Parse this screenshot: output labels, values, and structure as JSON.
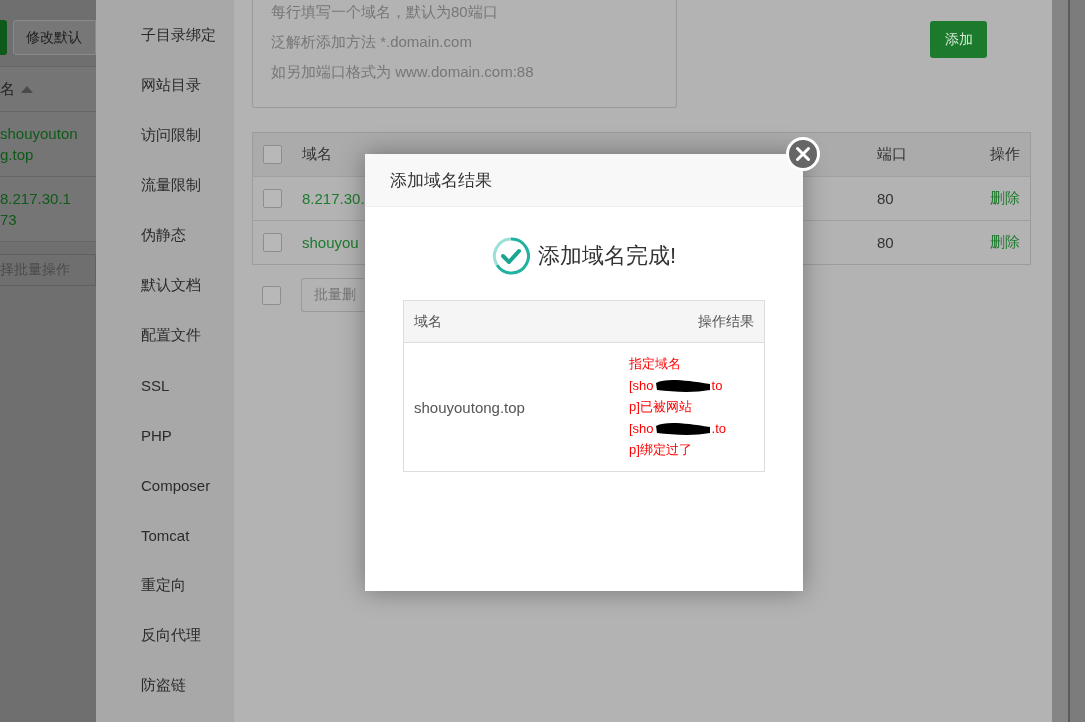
{
  "background_page": {
    "buttons": [
      "修改默认"
    ],
    "table": {
      "column": "名",
      "rows": [
        {
          "domain": "shouyoutong.top"
        },
        {
          "domain": "8.217.30.173"
        }
      ]
    },
    "batch_select": {
      "value": "择批量操作"
    }
  },
  "sidebar": {
    "items": [
      {
        "label": "子目录绑定"
      },
      {
        "label": "网站目录"
      },
      {
        "label": "访问限制"
      },
      {
        "label": "流量限制"
      },
      {
        "label": "伪静态"
      },
      {
        "label": "默认文档"
      },
      {
        "label": "配置文件"
      },
      {
        "label": "SSL"
      },
      {
        "label": "PHP"
      },
      {
        "label": "Composer"
      },
      {
        "label": "Tomcat"
      },
      {
        "label": "重定向"
      },
      {
        "label": "反向代理"
      },
      {
        "label": "防盗链"
      }
    ]
  },
  "domain_form": {
    "hint_lines": [
      "每行填写一个域名，默认为80端口",
      "泛解析添加方法 *.domain.com",
      "如另加端口格式为 www.domain.com:88"
    ],
    "add_button": "添加"
  },
  "domain_table": {
    "select_all_checked": false,
    "bottom_checked": false,
    "columns": [
      "域名",
      "端口",
      "操作"
    ],
    "rows": [
      {
        "domain": "8.217.30.",
        "port": "80",
        "action": "删除",
        "checked": false
      },
      {
        "domain": "shouyou",
        "port": "80",
        "action": "删除",
        "checked": false
      }
    ],
    "batch_button": "批量删"
  },
  "dialog": {
    "title": "添加域名结果",
    "message": "添加域名完成!",
    "columns": [
      "域名",
      "操作结果"
    ],
    "rows": [
      {
        "domain": "shouyoutong.top",
        "result_lines": [
          {
            "text": "指定域名",
            "redacted": false
          },
          {
            "text": "[sho",
            "redacted": true,
            "tail": "to"
          },
          {
            "text": "p]已被网站",
            "redacted": false
          },
          {
            "text": "[sho",
            "redacted": true,
            "tail": ".to"
          },
          {
            "text": "p]绑定过了",
            "redacted": false
          }
        ]
      }
    ]
  }
}
